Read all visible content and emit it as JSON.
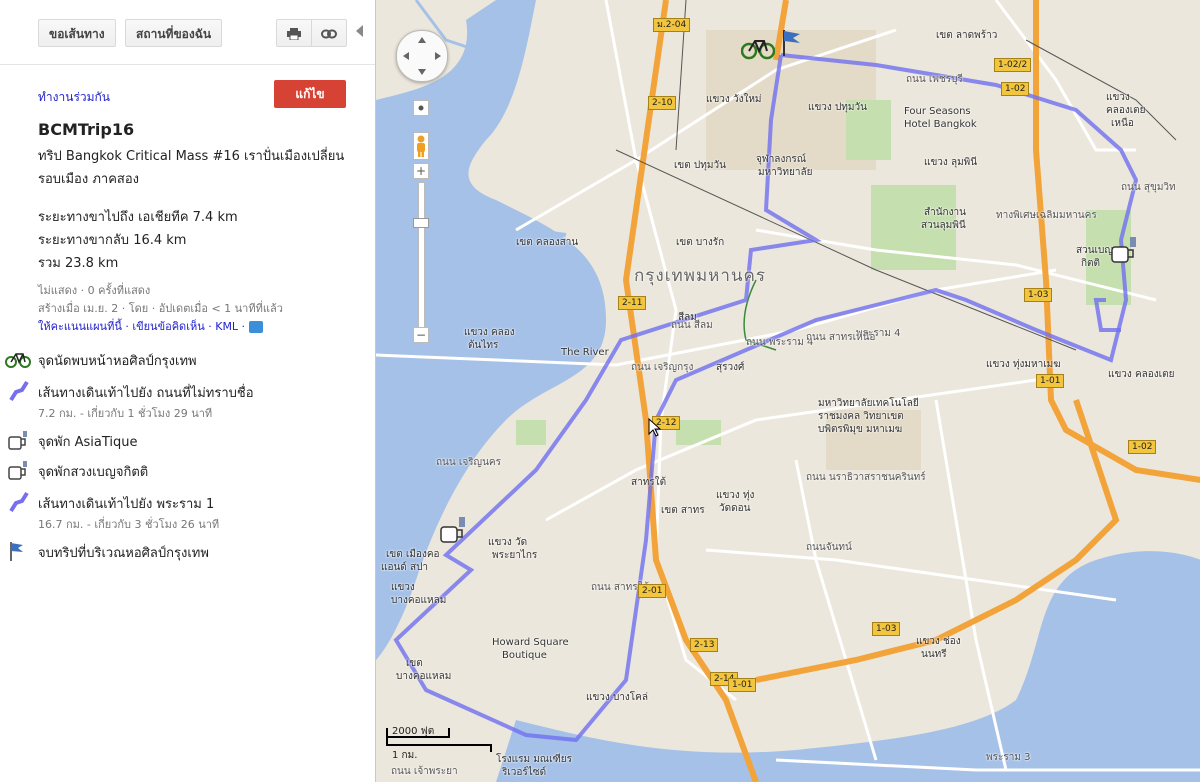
{
  "toolbar": {
    "directions": "ขอเส้นทาง",
    "my_places": "สถานที่ของฉัน",
    "print_icon": "printer-icon",
    "link_icon": "link-icon"
  },
  "panel": {
    "collaborate": "ทำงานร่วมกัน",
    "edit": "แก้ไข",
    "title": "BCMTrip16",
    "description": "ทริป Bangkok Critical Mass #16 เราปั่นเมืองเปลี่ยน รอบเมือง ภาคสอง",
    "distance_out": "ระยะทางขาไปถึง เอเชียทีค 7.4 km",
    "distance_back": "ระยะทางขากลับ 16.4 km",
    "distance_total": "รวม 23.8 km",
    "views": "ไม่แสดง · 0 ครั้งที่แสดง",
    "created": "สร้างเมื่อ เม.ย. 2 · โดย  · อัปเดตเมื่อ < 1 นาทีที่แล้ว",
    "links": "ให้คะแนนแผนที่นี้ · เขียนข้อคิดเห็น · KML ·",
    "items": [
      {
        "icon": "bicycle-icon",
        "label": "จุดนัดพบหน้าหอศิลป์กรุงเทพ",
        "sub": ""
      },
      {
        "icon": "route-line-icon",
        "label": "เส้นทางเดินเท้าไปยัง ถนนที่ไม่ทราบชื่อ",
        "sub": "7.2 กม. - เกี่ยวกับ 1 ชั่วโมง 29 นาที"
      },
      {
        "icon": "drink-icon",
        "label": "จุดพัก AsiaTique",
        "sub": ""
      },
      {
        "icon": "drink-icon",
        "label": "จุดพักสวงเบญจกิตติ",
        "sub": ""
      },
      {
        "icon": "route-line-icon",
        "label": "เส้นทางเดินเท้าไปยัง พระราม 1",
        "sub": "16.7 กม. - เกี่ยวกับ 3 ชั่วโมง 26 นาที"
      },
      {
        "icon": "flag-icon",
        "label": "จบทริปที่บริเวณหอศิลป์กรุงเทพ",
        "sub": ""
      }
    ]
  },
  "map": {
    "colors": {
      "route": "#6f6ff0",
      "river": "#a5c1e8",
      "highway": "#f2a43a",
      "park": "#c6dfae"
    },
    "labels": [
      {
        "text": "กรุงเทพมหานคร",
        "cls": "big"
      },
      {
        "text": "เขต ปทุมวัน"
      },
      {
        "text": "เขต บางรัก"
      },
      {
        "text": "เขต สาทร"
      },
      {
        "text": "เขต คลองสาน"
      },
      {
        "text": "The River"
      },
      {
        "text": "Four Seasons"
      },
      {
        "text": "Hotel Bangkok"
      },
      {
        "text": "Howard Square"
      },
      {
        "text": "Boutique"
      },
      {
        "text": "สวนเบญจ"
      },
      {
        "text": "กิตติ"
      },
      {
        "text": "แขวง ปทุมวัน"
      },
      {
        "text": "แขวง ลุมพินี"
      },
      {
        "text": "แขวง วังใหม่"
      },
      {
        "text": "จุฬาลงกรณ์"
      },
      {
        "text": "มหาวิทยาลัย"
      },
      {
        "text": "สำนักงาน"
      },
      {
        "text": "สวนลุมพินี"
      },
      {
        "text": "มหาวิทยาลัยเทคโนโลยี"
      },
      {
        "text": "ราชมงคล วิทยาเขต"
      },
      {
        "text": "บพิตรพิมุข มหาเมฆ"
      },
      {
        "text": "แขวง ทุ่งมหาเมฆ"
      },
      {
        "text": "แขวง ทุ่ง"
      },
      {
        "text": "วัดดอน"
      },
      {
        "text": "แขวง ช่อง"
      },
      {
        "text": "นนทรี"
      },
      {
        "text": "แขวง คลองเตย"
      },
      {
        "text": "แขวง"
      },
      {
        "text": "คลองเตย"
      },
      {
        "text": "เหนือ"
      },
      {
        "text": "เขต"
      },
      {
        "text": "บางคอแหลม"
      },
      {
        "text": "แขวง วัด"
      },
      {
        "text": "พระยาไกร"
      },
      {
        "text": "แขวง"
      },
      {
        "text": "บางคอแหลม"
      },
      {
        "text": "สาทรใต้"
      },
      {
        "text": "สีลม"
      },
      {
        "text": "สุรวงศ์"
      },
      {
        "text": "ถนน เพชรบุรี"
      },
      {
        "text": "ถนน สาทรใต้"
      },
      {
        "text": "พระราม 3"
      },
      {
        "text": "พระราม 4"
      },
      {
        "text": "ถนน สุขุมวิท"
      },
      {
        "text": "แขวง คลอง"
      },
      {
        "text": "ต้นไทร"
      },
      {
        "text": "โรงแรม มณเฑียร"
      },
      {
        "text": "ริเวอร์ไซด์"
      },
      {
        "text": "แขวง บางโคล่"
      },
      {
        "text": "ถนนจันทน์"
      },
      {
        "text": "ถนน พระราม 4"
      },
      {
        "text": "ทางพิเศษเฉลิมมหานคร"
      },
      {
        "text": "ถนน เจริญนคร"
      },
      {
        "text": "ถนน เจริญกรุง"
      },
      {
        "text": "ถนน สีลม"
      },
      {
        "text": "ถนน สาทรเหนือ"
      },
      {
        "text": "เขต เมืองคอ"
      },
      {
        "text": "แอนด์ สปา"
      },
      {
        "text": "เขต ลาดพร้าว"
      },
      {
        "text": "ถนน นราธิวาสราชนครินทร์"
      },
      {
        "text": "ถนน เจ้าพระยา"
      }
    ],
    "shields": [
      "ม.2-04",
      "2-10",
      "2-11",
      "2-12",
      "2-01",
      "2-13",
      "2-14",
      "1-01",
      "1-02",
      "1-02/2",
      "1-03",
      "1-01",
      "1-02",
      "1-03"
    ],
    "markers": [
      "bicycle-icon",
      "flag-icon",
      "drink-icon",
      "drink-icon"
    ],
    "scale_feet": "2000 ฟุต",
    "scale_km": "1 กม."
  }
}
